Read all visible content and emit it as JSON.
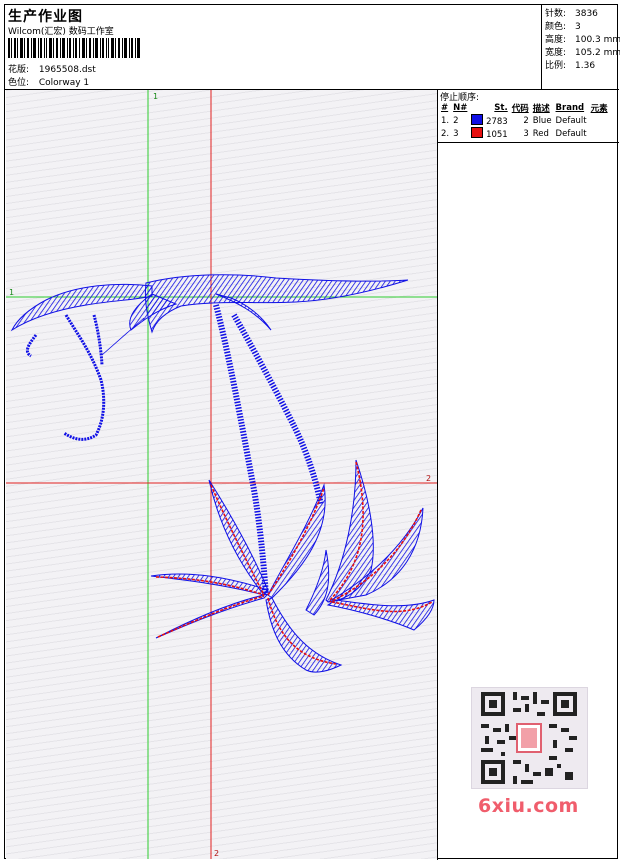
{
  "header": {
    "title": "生产作业图",
    "company": "Wilcom(汇宏) 数码工作室",
    "design_label": "花版:",
    "design_value": "1965508.dst",
    "colorway_label": "色位:",
    "colorway_value": "Colorway 1"
  },
  "specs": [
    {
      "label": "针数:",
      "value": "3836"
    },
    {
      "label": "颜色:",
      "value": "3"
    },
    {
      "label": "高度:",
      "value": "100.3 mm"
    },
    {
      "label": "宽度:",
      "value": "105.2 mm"
    },
    {
      "label": "比例:",
      "value": "1.36"
    }
  ],
  "stops": {
    "title": "停止顺序:",
    "columns": [
      "#",
      "N#",
      "St.",
      "代码",
      "描述",
      "Brand",
      "元素"
    ],
    "rows": [
      {
        "num": "1.",
        "n": "2",
        "color": "#1010e6",
        "stitches": "2783",
        "code": "2",
        "desc": "Blue",
        "brand": "Default",
        "element": ""
      },
      {
        "num": "2.",
        "n": "3",
        "color": "#e61010",
        "stitches": "1051",
        "code": "3",
        "desc": "Red",
        "brand": "Default",
        "element": ""
      }
    ]
  },
  "guides": {
    "green_v": "1",
    "green_h": "1",
    "red_h": "2",
    "red_v": "2"
  },
  "colors": {
    "guide_green": "#2ecc2e",
    "guide_red": "#e02020",
    "thread_blue": "#1010e6",
    "thread_red": "#e61010"
  },
  "watermark": {
    "text": "6xiu.com",
    "qr_icon": "qr-code-icon"
  }
}
